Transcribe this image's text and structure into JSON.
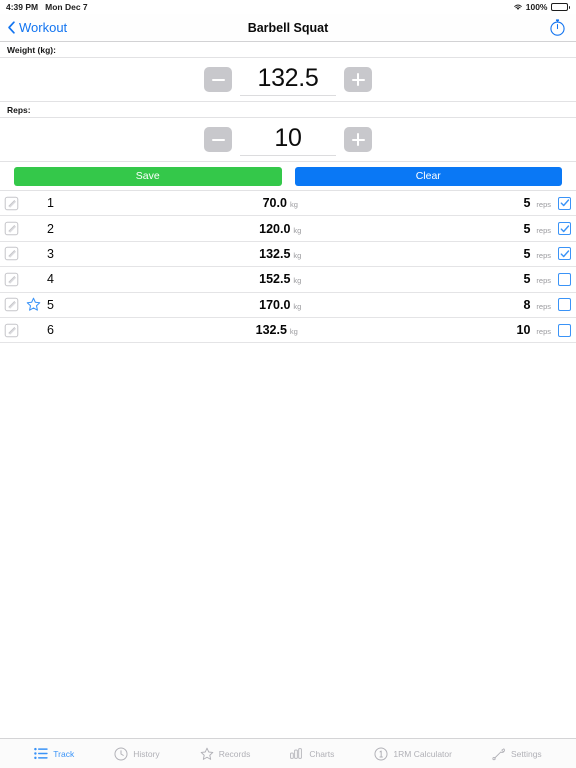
{
  "statusbar": {
    "time": "4:39 PM",
    "date": "Mon Dec 7",
    "battery_percent": "100%",
    "wifi_icon": "wifi-icon",
    "battery_icon": "battery-full-icon"
  },
  "navbar": {
    "back_label": "Workout",
    "back_icon": "chevron-left-icon",
    "title": "Barbell Squat",
    "timer_icon": "stopwatch-icon"
  },
  "inputs": {
    "weight_label": "Weight (kg):",
    "weight_value": "132.5",
    "reps_label": "Reps:",
    "reps_value": "10",
    "decrement_icon": "minus-icon",
    "increment_icon": "plus-icon"
  },
  "actions": {
    "save_label": "Save",
    "clear_label": "Clear",
    "save_color": "#34c84a",
    "clear_color": "#0a78f5"
  },
  "units": {
    "weight": "kg",
    "reps": "reps"
  },
  "sets": [
    {
      "index": "1",
      "weight": "70.0",
      "reps": "5",
      "checked": true,
      "record": false
    },
    {
      "index": "2",
      "weight": "120.0",
      "reps": "5",
      "checked": true,
      "record": false
    },
    {
      "index": "3",
      "weight": "132.5",
      "reps": "5",
      "checked": true,
      "record": false
    },
    {
      "index": "4",
      "weight": "152.5",
      "reps": "5",
      "checked": false,
      "record": false
    },
    {
      "index": "5",
      "weight": "170.0",
      "reps": "8",
      "checked": false,
      "record": true
    },
    {
      "index": "6",
      "weight": "132.5",
      "reps": "10",
      "checked": false,
      "record": false
    }
  ],
  "tabs": [
    {
      "label": "Track",
      "icon": "list-icon",
      "active": true
    },
    {
      "label": "History",
      "icon": "clock-icon",
      "active": false
    },
    {
      "label": "Records",
      "icon": "star-icon",
      "active": false
    },
    {
      "label": "Charts",
      "icon": "bar-chart-icon",
      "active": false
    },
    {
      "label": "1RM Calculator",
      "icon": "circle-one-icon",
      "active": false
    },
    {
      "label": "Settings",
      "icon": "wrench-icon",
      "active": false
    }
  ],
  "colors": {
    "accent": "#3a93f7",
    "link": "#1274f0",
    "success": "#34c84a"
  }
}
